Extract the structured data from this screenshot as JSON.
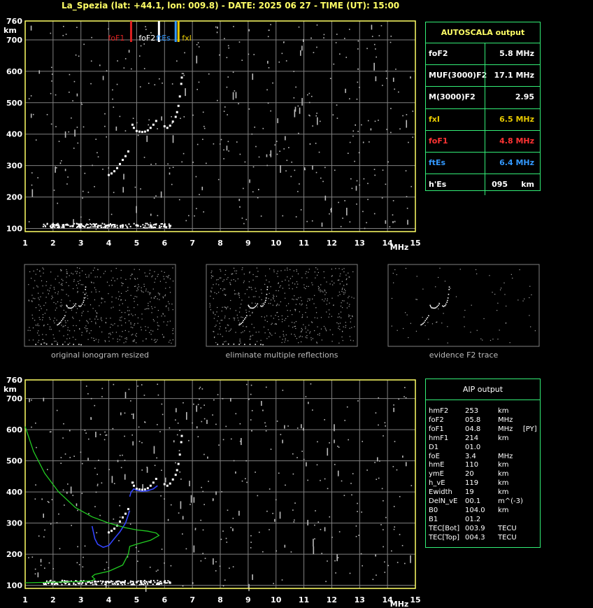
{
  "title": "La_Spezia (lat: +44.1, lon: 009.8) - DATE: 2025 06 27 - TIME (UT): 15:00",
  "colors": {
    "grid": "#808080",
    "frame": "#ffff66",
    "panel_border": "#33ee77",
    "foF1": "#dd2222",
    "ftEs": "#3399ff",
    "fxI": "#e6c800",
    "profile": "#22cc22",
    "trace": "#3344ff",
    "white": "#ffffff"
  },
  "axes": {
    "km_label": "km",
    "mhz_label": "MHz",
    "y_ticks": [
      100,
      200,
      300,
      400,
      500,
      600,
      700,
      760
    ],
    "x_ticks": [
      1,
      2,
      3,
      4,
      5,
      6,
      7,
      8,
      9,
      10,
      11,
      12,
      13,
      14,
      15
    ],
    "xlim": [
      1,
      15
    ],
    "ylim": [
      90,
      760
    ]
  },
  "markers": [
    {
      "label": "foF1",
      "freq": 4.8,
      "color": "#dd2222"
    },
    {
      "label": "foF2",
      "freq": 5.8,
      "color": "#ffffff"
    },
    {
      "label": "ftEs",
      "freq": 6.4,
      "color": "#3399ff"
    },
    {
      "label": "fxI",
      "freq": 6.5,
      "color": "#e6c800"
    }
  ],
  "chart_data": [
    {
      "type": "scatter",
      "series": [
        {
          "name": "F2 trace",
          "points": [
            [
              4.85,
              430
            ],
            [
              4.9,
              420
            ],
            [
              5.0,
              410
            ],
            [
              5.1,
              408
            ],
            [
              5.2,
              407
            ],
            [
              5.3,
              408
            ],
            [
              5.4,
              412
            ],
            [
              5.5,
              420
            ],
            [
              5.6,
              430
            ],
            [
              5.7,
              442
            ],
            [
              6.0,
              425
            ],
            [
              6.1,
              420
            ],
            [
              6.2,
              427
            ],
            [
              6.3,
              440
            ],
            [
              6.4,
              455
            ],
            [
              6.45,
              470
            ],
            [
              6.5,
              490
            ],
            [
              6.55,
              520
            ],
            [
              6.6,
              560
            ],
            [
              6.62,
              580
            ]
          ]
        },
        {
          "name": "F1 trace",
          "points": [
            [
              4.0,
              270
            ],
            [
              4.1,
              275
            ],
            [
              4.2,
              282
            ],
            [
              4.3,
              292
            ],
            [
              4.4,
              305
            ],
            [
              4.5,
              318
            ],
            [
              4.6,
              330
            ],
            [
              4.7,
              345
            ]
          ]
        },
        {
          "name": "E layer",
          "points": [
            [
              2.0,
              110
            ],
            [
              2.5,
              112
            ],
            [
              3.0,
              113
            ],
            [
              3.5,
              112
            ],
            [
              4.0,
              110
            ],
            [
              4.5,
              110
            ],
            [
              5.0,
              110
            ],
            [
              5.5,
              110
            ],
            [
              6.0,
              110
            ],
            [
              6.2,
              108
            ]
          ]
        }
      ]
    },
    {
      "type": "line",
      "series": [
        {
          "name": "AIP F2 trace",
          "points": [
            [
              4.75,
              385
            ],
            [
              4.8,
              400
            ],
            [
              4.9,
              410
            ],
            [
              5.0,
              405
            ],
            [
              5.2,
              402
            ],
            [
              5.4,
              404
            ],
            [
              5.6,
              410
            ],
            [
              5.75,
              420
            ]
          ]
        },
        {
          "name": "AIP F1 trace",
          "points": [
            [
              3.4,
              290
            ],
            [
              3.5,
              250
            ],
            [
              3.6,
              232
            ],
            [
              3.8,
              222
            ],
            [
              4.0,
              228
            ],
            [
              4.2,
              250
            ],
            [
              4.4,
              272
            ],
            [
              4.6,
              300
            ],
            [
              4.75,
              340
            ]
          ]
        },
        {
          "name": "AIP profile",
          "points": [
            [
              1.0,
              610
            ],
            [
              1.3,
              530
            ],
            [
              1.7,
              460
            ],
            [
              2.2,
              400
            ],
            [
              2.8,
              350
            ],
            [
              3.4,
              320
            ],
            [
              4.0,
              300
            ],
            [
              4.6,
              285
            ],
            [
              5.0,
              278
            ],
            [
              5.4,
              274
            ],
            [
              5.7,
              268
            ],
            [
              5.8,
              260
            ],
            [
              5.5,
              245
            ],
            [
              5.0,
              232
            ],
            [
              4.75,
              225
            ],
            [
              4.7,
              200
            ],
            [
              4.5,
              165
            ],
            [
              4.0,
              145
            ],
            [
              3.5,
              135
            ],
            [
              3.4,
              128
            ],
            [
              3.5,
              120
            ],
            [
              3.4,
              115
            ],
            [
              3.0,
              112
            ],
            [
              2.0,
              110
            ],
            [
              1.0,
              108
            ]
          ]
        }
      ]
    }
  ],
  "thumbnails": {
    "original": "original ionogram resized",
    "eliminate": "eliminate multiple reflections",
    "evidence": "evidence F2 trace"
  },
  "autoscala": {
    "title": "AUTOSCALA output",
    "rows": [
      {
        "label": "foF2",
        "value": "5.8 MHz",
        "color": "#ffffff"
      },
      {
        "label": "MUF(3000)F2",
        "value": "17.1 MHz",
        "color": "#ffffff"
      },
      {
        "label": "M(3000)F2",
        "value": "2.95",
        "color": "#ffffff"
      },
      {
        "label": "fxI",
        "value": "6.5 MHz",
        "color": "#e6c800"
      },
      {
        "label": "foF1",
        "value": "4.8 MHz",
        "color": "#ff3333"
      },
      {
        "label": "ftEs",
        "value": "6.4 MHz",
        "color": "#3399ff"
      },
      {
        "label": "h'Es",
        "value": "095     km",
        "color": "#ffffff"
      }
    ]
  },
  "aip": {
    "title": "AIP output",
    "rows": [
      [
        "hmF2",
        "253",
        "km",
        ""
      ],
      [
        "foF2",
        "05.8",
        "MHz",
        ""
      ],
      [
        "foF1",
        "04.8",
        "MHz",
        "[PY]"
      ],
      [
        "hmF1",
        "214",
        "km",
        ""
      ],
      [
        "D1",
        "01.0",
        "",
        ""
      ],
      [
        "foE",
        "3.4",
        "MHz",
        ""
      ],
      [
        "hmE",
        "110",
        "km",
        ""
      ],
      [
        "ymE",
        "20",
        "km",
        ""
      ],
      [
        "h_vE",
        "119",
        "km",
        ""
      ],
      [
        "Ewidth",
        "19",
        "km",
        ""
      ],
      [
        "DelN_vE",
        "00.1",
        "m^(-3)",
        ""
      ],
      [
        "B0",
        "104.0",
        "km",
        ""
      ],
      [
        "B1",
        "01.2",
        "",
        ""
      ],
      [
        "TEC[Bot]",
        "003.9",
        "TECU",
        ""
      ],
      [
        "TEC[Top]",
        "004.3",
        "TECU",
        ""
      ]
    ]
  }
}
